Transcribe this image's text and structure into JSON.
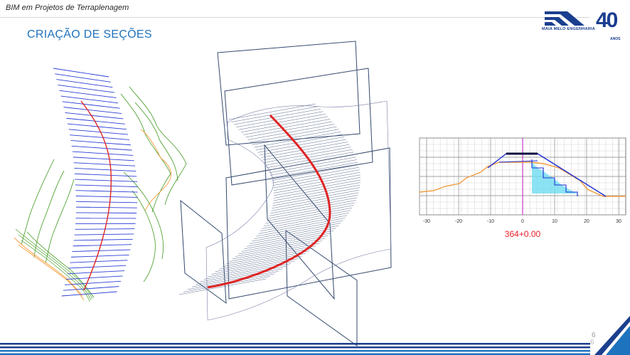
{
  "header": {
    "title": "BIM em Projetos de Terraplenagem"
  },
  "slide": {
    "title": "CRIAÇÃO DE SEÇÕES",
    "page_number": "6",
    "page_number_shadow": "6"
  },
  "logo": {
    "company": "MAIA MELO ENGENHARIA",
    "number": "40",
    "suffix": "ANOS"
  },
  "colors": {
    "title_blue": "#1e73be",
    "brand_navy": "#1b3f8f",
    "alignment_red": "#e02424",
    "station_blue": "#2b3fd6",
    "terrain_green": "#3f9a1e",
    "terrain_orange": "#f39c3a",
    "section_label_red": "#e8202a"
  },
  "section_view": {
    "station_label": "364+0.00",
    "x_ticks": [
      "-30",
      "-20",
      "-10",
      "0",
      "10",
      "20",
      "30"
    ]
  }
}
